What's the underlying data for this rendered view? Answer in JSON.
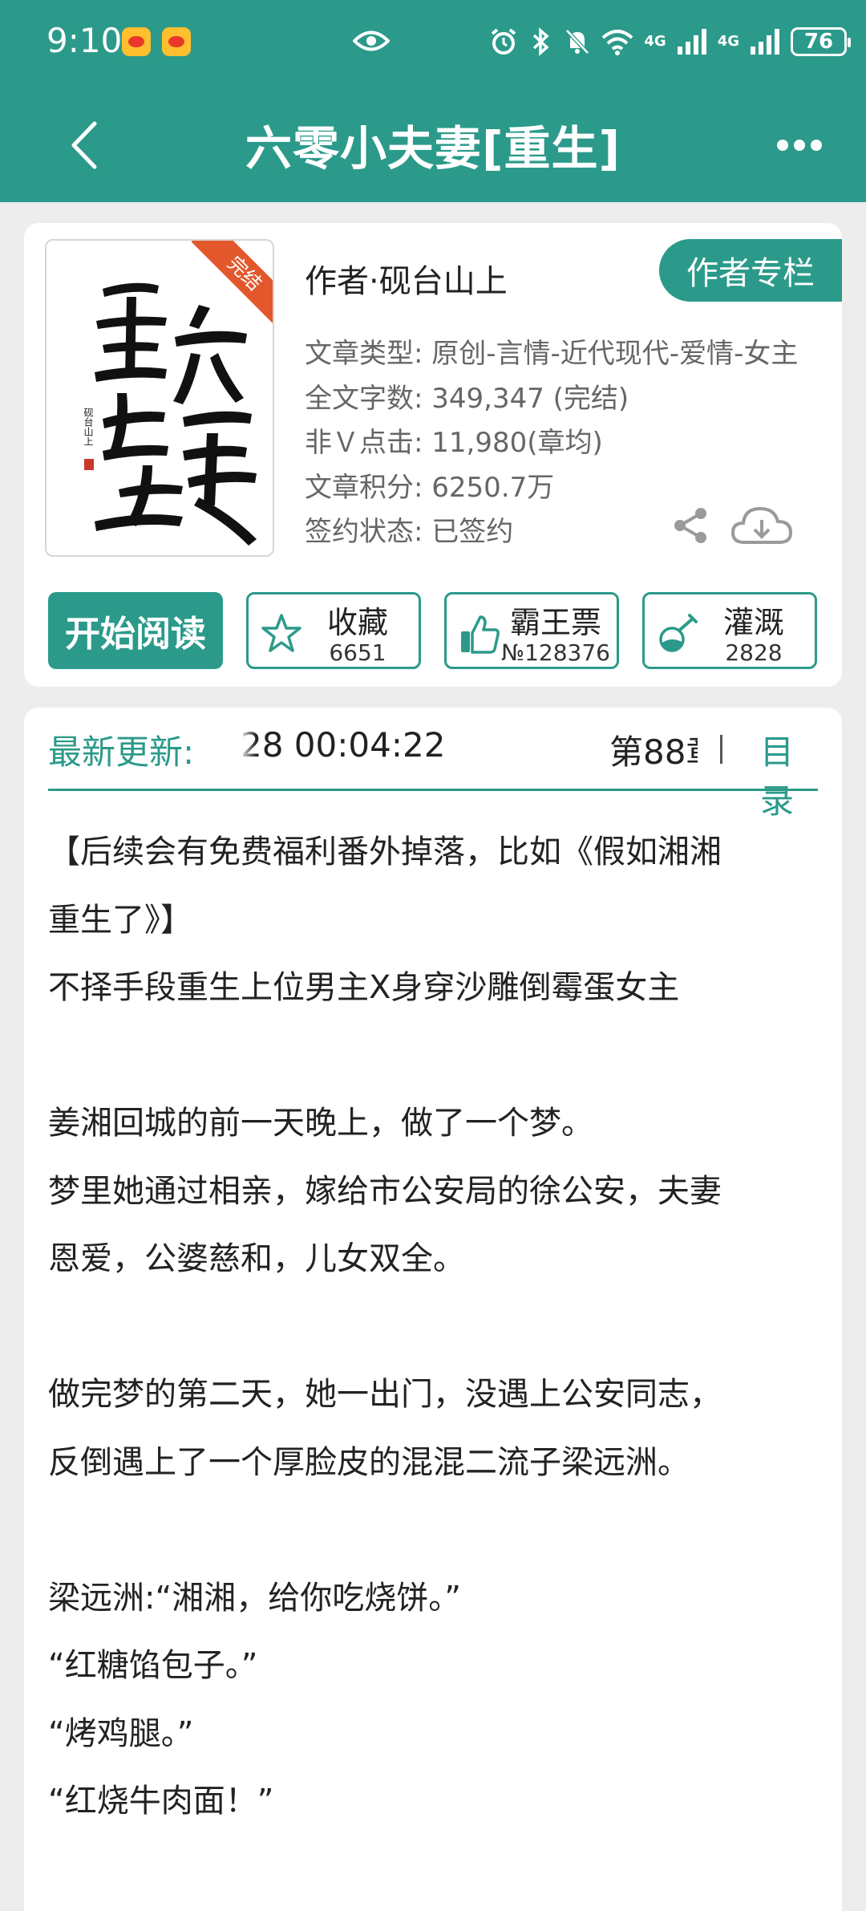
{
  "status_bar": {
    "time": "9:10",
    "network_1": "4G",
    "network_2": "4G",
    "battery": "76",
    "icons": [
      "weibo-icon",
      "weibo-icon",
      "eye-icon",
      "alarm-icon",
      "bluetooth-icon",
      "mute-icon",
      "wifi-icon",
      "signal-icon",
      "signal-icon",
      "battery-icon"
    ]
  },
  "nav": {
    "title": "六零小夫妻[重生]",
    "back_icon": "chevron-left-icon",
    "more_icon": "more-dots-icon"
  },
  "book": {
    "author_line": "作者·砚台山上",
    "author_column_label": "作者专栏",
    "cover_badge": "完结",
    "cover_title": "重生在六零",
    "cover_author": "砚台山上",
    "meta": [
      "文章类型: 原创-言情-近代现代-爱情-女主",
      "全文字数: 349,347 (完结)",
      "非Ｖ点击: 11,980(章均)",
      "文章积分: 6250.7万",
      "签约状态: 已签约"
    ]
  },
  "actions": {
    "read_label": "开始阅读",
    "collect": {
      "label": "收藏",
      "count": "6651",
      "icon": "star-icon"
    },
    "tickets": {
      "label": "霸王票",
      "count": "№128376",
      "icon": "thumbs-up-icon"
    },
    "nutrient": {
      "label": "灌溉",
      "count": "2828",
      "icon": "flask-icon"
    }
  },
  "update": {
    "label": "最新更新:",
    "time": "28 00:04:22",
    "chapter": "第88章",
    "toc_label": "目录"
  },
  "synopsis": [
    "【后续会有免费福利番外掉落，比如《假如湘湘",
    "重生了》】",
    "不择手段重生上位男主X身穿沙雕倒霉蛋女主",
    "",
    "姜湘回城的前一天晚上，做了一个梦。",
    "梦里她通过相亲，嫁给市公安局的徐公安，夫妻",
    "恩爱，公婆慈和，儿女双全。",
    "",
    "做完梦的第二天，她一出门，没遇上公安同志，",
    "反倒遇上了一个厚脸皮的混混二流子梁远洲。",
    "",
    "梁远洲:“湘湘，给你吃烧饼。”",
    "“红糖馅包子。”",
    "“烤鸡腿。”",
    "“红烧牛肉面！”"
  ],
  "colors": {
    "accent": "#2b9a8a",
    "background": "#ededed",
    "ribbon": "#e2582c"
  }
}
